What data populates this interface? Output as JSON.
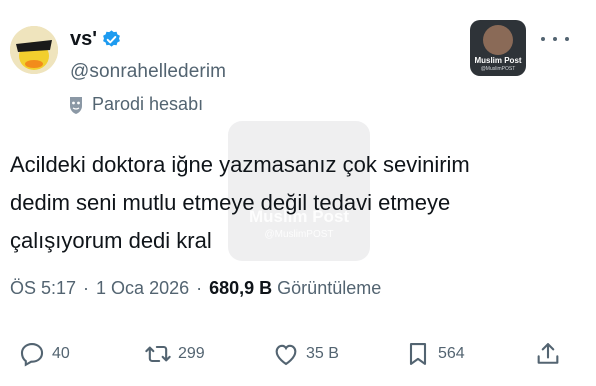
{
  "author": {
    "display_name": "vs'",
    "handle": "@sonrahellederim",
    "label": "Parodi hesabı",
    "verified_color": "#1d9bf0"
  },
  "thumbnail": {
    "label": "Muslim Post",
    "sub": "@MuslimPOST"
  },
  "watermark": {
    "title": "Muslim Post",
    "sub": "@MuslimPOST"
  },
  "tweet": {
    "lines": [
      "Acildeki doktora iğne yazmasanız çok sevinirim",
      "dedim seni mutlu etmeye değil tedavi etmeye",
      "çalışıyorum dedi kral"
    ]
  },
  "meta": {
    "time": "ÖS 5:17",
    "separator": "·",
    "date": "1 Oca 2026",
    "views_count": "680,9 B",
    "views_label": "Görüntüleme"
  },
  "actions": {
    "replies": "40",
    "reposts": "299",
    "likes": "35 B",
    "bookmarks": "564"
  },
  "icons": [
    "avatar",
    "verified-badge-icon",
    "parody-mask-icon",
    "more-icon",
    "reply-icon",
    "repost-icon",
    "like-icon",
    "bookmark-icon",
    "share-icon"
  ],
  "colors": {
    "text": "#0f1419",
    "secondary": "#536471",
    "accent": "#1d9bf0"
  }
}
